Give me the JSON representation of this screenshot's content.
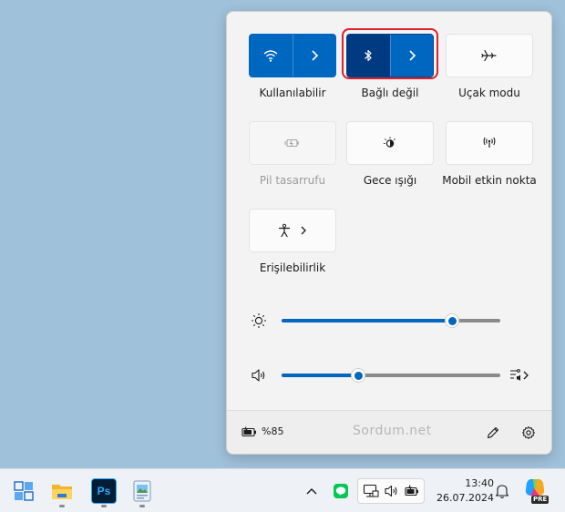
{
  "quick_settings": {
    "tiles": [
      {
        "label": "Kullanılabilir",
        "icon": "wifi-icon",
        "state": "on"
      },
      {
        "label": "Bağlı değil",
        "icon": "bluetooth-icon",
        "state": "on"
      },
      {
        "label": "Uçak modu",
        "icon": "airplane-icon",
        "state": "off"
      },
      {
        "label": "Pil tasarrufu",
        "icon": "battery-saver-icon",
        "state": "disabled"
      },
      {
        "label": "Gece ışığı",
        "icon": "night-light-icon",
        "state": "off"
      },
      {
        "label": "Mobil etkin nokta",
        "icon": "mobile-hotspot-icon",
        "state": "off"
      },
      {
        "label": "Erişilebilirlik",
        "icon": "accessibility-icon",
        "state": "off"
      }
    ],
    "brightness": {
      "value_percent": 78,
      "icon": "brightness-icon"
    },
    "volume": {
      "value_percent": 35,
      "icon": "volume-icon"
    },
    "footer": {
      "battery": "%85",
      "watermark": "Sordum.net"
    }
  },
  "taskbar": {
    "clock": {
      "time": "13:40",
      "date": "26.07.2024"
    },
    "apps": [
      "start-icon",
      "file-explorer-icon",
      "photoshop-icon",
      "paint-icon"
    ],
    "photoshop_label": "Ps",
    "copilot_badge": "PRE"
  },
  "colors": {
    "accent": "#0067c0",
    "accent_dark": "#003a80",
    "highlight": "#e0202a",
    "desktop": "#9fc1d9"
  }
}
